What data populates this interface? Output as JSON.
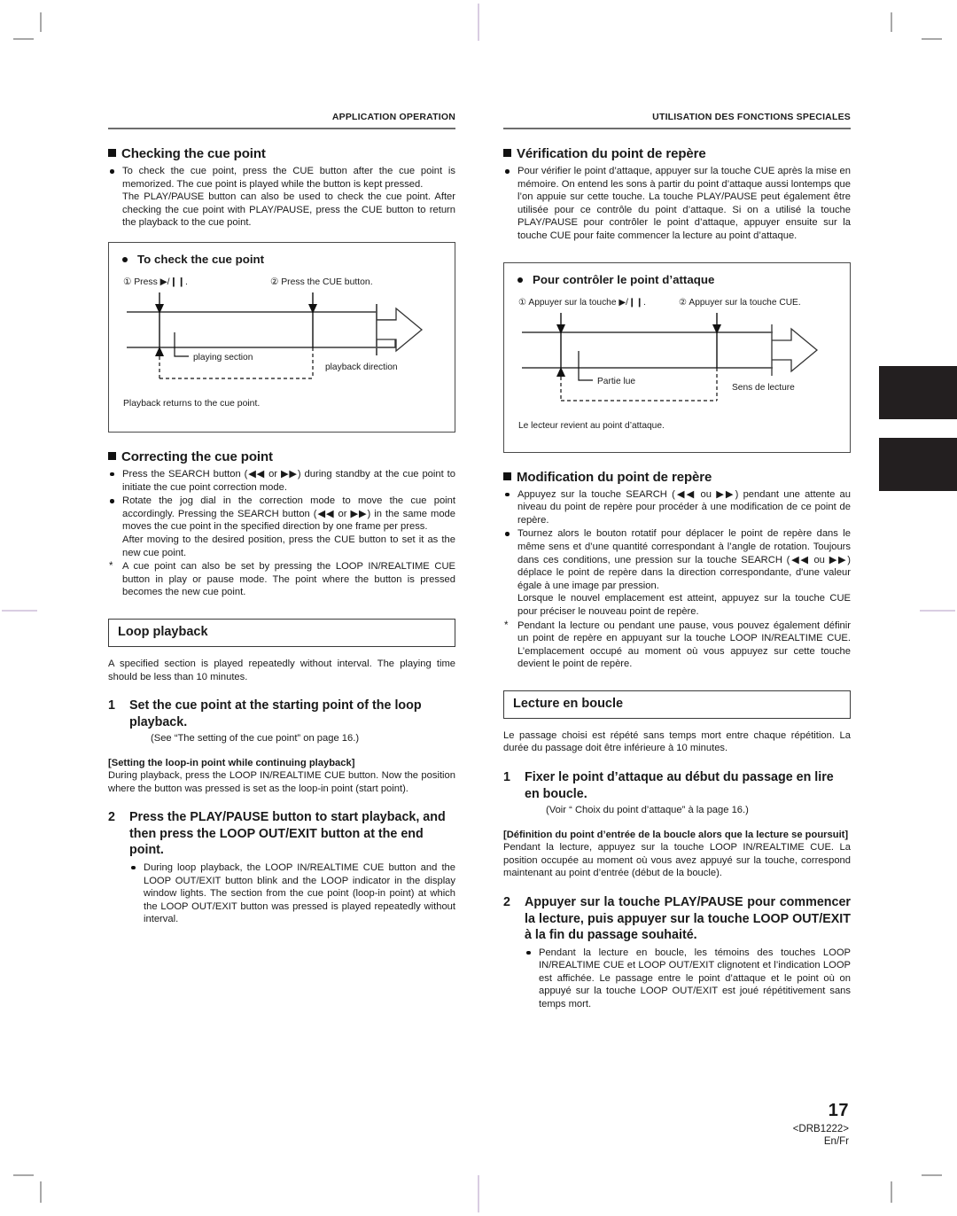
{
  "page": {
    "number": "17",
    "model_code": "<DRB1222>",
    "language_code": "En/Fr"
  },
  "left_column": {
    "running_head": "APPLICATION OPERATION",
    "section_checking": {
      "heading": "Checking the cue point",
      "bullet1_line1": "To check the cue point, press the CUE button after the cue point is memorized.  The cue point is played while the button is kept pressed.",
      "bullet1_line2": "The PLAY/PAUSE button can also be used to check the cue point. After checking the cue point with PLAY/PAUSE, press the CUE button to return the playback to the cue point."
    },
    "figure": {
      "title": "To check the cue point",
      "label_step1": "①  Press ▶/❙❙.",
      "label_step2": "②  Press the CUE button.",
      "label_playing_section": "playing section",
      "label_playback_direction": "playback direction",
      "caption": "Playback returns to the cue point."
    },
    "section_correcting": {
      "heading": "Correcting the cue point",
      "bullet1": "Press the SEARCH button (◀◀ or ▶▶) during standby at the cue point to initiate the cue point correction mode.",
      "bullet2_line1": "Rotate the jog dial in the correction mode to move the cue point accordingly. Pressing the SEARCH button (◀◀ or ▶▶) in the same mode moves the cue point in the specified direction by one frame per press.",
      "bullet2_line2": "After moving to the desired position, press the CUE button to set it as the new cue point.",
      "note": "A cue point can also be set by pressing the LOOP IN/REALTIME CUE button in play or pause mode. The point where the button is pressed becomes the new cue point."
    },
    "section_loop": {
      "heading": "Loop playback",
      "intro": "A specified section is played repeatedly without interval.  The playing time should be less than 10 minutes.",
      "step1_number": "1",
      "step1_text": "Set the cue point at the starting point of the loop playback.",
      "step1_sub": "(See “The setting of the cue point” on page 16.)",
      "bracket_heading": "[Setting the loop-in point while continuing playback]",
      "bracket_body": "During playback, press the LOOP IN/REALTIME CUE button. Now the position where the button was pressed is set as the loop-in point (start point).",
      "step2_number": "2",
      "step2_text": "Press the PLAY/PAUSE button to start playback, and then press the LOOP OUT/EXIT button at the end point.",
      "step2_bullet": "During loop playback, the LOOP IN/REALTIME CUE button and the LOOP OUT/EXIT button blink and the LOOP indicator in the display window lights.  The section from the cue point (loop-in point) at which the LOOP OUT/EXIT button was pressed is played repeatedly without interval."
    }
  },
  "right_column": {
    "running_head": "UTILISATION DES FONCTIONS SPECIALES",
    "section_verification": {
      "heading": "Vérification du point de repère",
      "bullet1": "Pour vérifier le point d’attaque, appuyer sur la touche CUE après la mise en mémoire. On entend les sons à partir du point d’attaque aussi lontemps que l’on appuie sur cette touche. La touche PLAY/PAUSE peut également être utilisée pour ce contrôle du point d’attaque. Si on a utilisé la touche PLAY/PAUSE pour contrôler le point d’attaque, appuyer ensuite sur la touche CUE pour faite commencer la lecture au point d’attaque."
    },
    "figure": {
      "title": "Pour contrôler le point d’attaque",
      "label_step1": "①  Appuyer sur la touche ▶/❙❙.",
      "label_step2": "②  Appuyer sur la touche CUE.",
      "label_playing_section": "Partie lue",
      "label_playback_direction": "Sens de lecture",
      "caption": "Le lecteur revient au point d’attaque."
    },
    "section_modification": {
      "heading": "Modification du point de repère",
      "bullet1": "Appuyez sur la touche SEARCH (◀◀ ou ▶▶) pendant une attente au niveau du point de repère pour procéder à une modification de ce point de repère.",
      "bullet2_line1": "Tournez alors le bouton rotatif pour déplacer le point de repère dans le même sens et d’une quantité correspondant à l’angle de rotation. Toujours dans ces conditions, une pression sur la touche SEARCH (◀◀ ou ▶▶) déplace le point de repère dans la direction correspondante, d'une valeur égale à une image par pression.",
      "bullet2_line2": "Lorsque le nouvel emplacement est atteint, appuyez sur la touche CUE pour préciser le nouveau point de repère.",
      "note": "Pendant la lecture ou pendant une pause, vous pouvez également définir un point de repère en appuyant sur la touche LOOP IN/REALTIME CUE. L’emplacement occupé au moment où vous appuyez sur cette touche devient le point de repère."
    },
    "section_loop": {
      "heading": "Lecture en boucle",
      "intro": "Le passage choisi est répété sans temps mort entre chaque répétition. La durée du passage doit être inférieure à 10 minutes.",
      "step1_number": "1",
      "step1_text": "Fixer le point d’attaque au début du passage en lire en boucle.",
      "step1_sub": "(Voir “ Choix du point d’attaque” à la page 16.)",
      "bracket_heading": "[Définition du point d’entrée de la boucle alors que la lecture se poursuit]",
      "bracket_body": "Pendant la lecture, appuyez sur la touche LOOP IN/REALTIME CUE. La position occupée au moment où vous avez appuyé sur la touche, correspond maintenant au point d’entrée (début de la boucle).",
      "step2_number": "2",
      "step2_text": "Appuyer sur la touche PLAY/PAUSE pour commencer la lecture, puis appuyer sur la touche LOOP OUT/EXIT à la fin du passage souhaité.",
      "step2_bullet": "Pendant la lecture en boucle, les témoins des touches LOOP IN/REALTIME CUE et LOOP OUT/EXIT clignotent et l’indication LOOP est affichée. Le passage entre le point d’attaque et le point où on appuyé sur la touche LOOP OUT/EXIT est joué répétitivement sans temps mort."
    }
  },
  "colors": {
    "text": "#1a1a1a",
    "rule": "#6d6d6d",
    "box_border": "#4a4a4a",
    "thumb_tab": "#231f20",
    "crop_mark": "#a8a8a8"
  }
}
